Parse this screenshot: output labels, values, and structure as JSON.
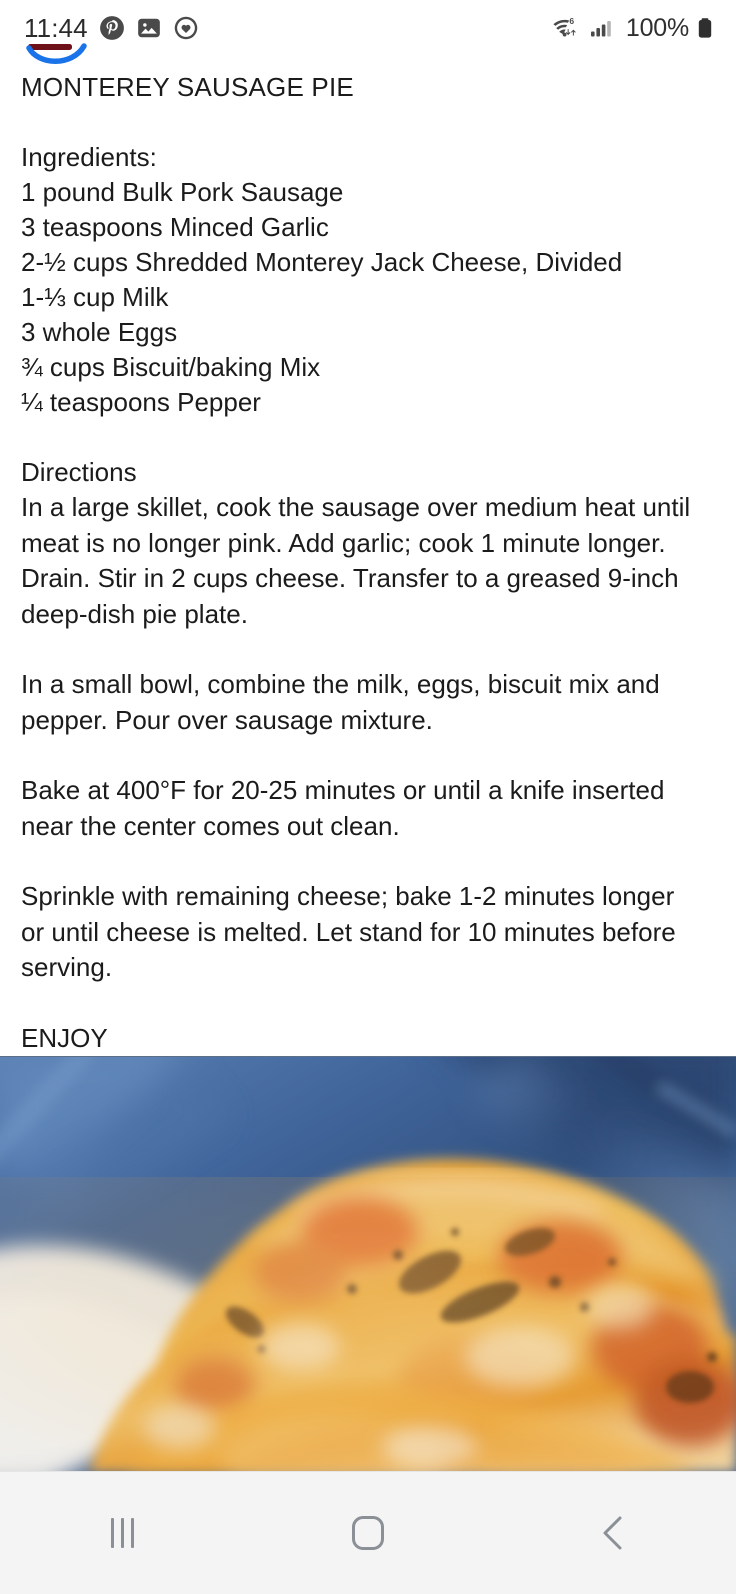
{
  "status_bar": {
    "time": "11:44",
    "battery_percent": "100%",
    "icons": [
      {
        "name": "pinterest-icon"
      },
      {
        "name": "gallery-photo-icon"
      },
      {
        "name": "samsung-health-heart-icon"
      }
    ],
    "right_icons": [
      {
        "name": "wifi-6-icon",
        "label": "6"
      },
      {
        "name": "cellular-signal-icon"
      },
      {
        "name": "battery-icon"
      }
    ],
    "accent_blue": "#1a73e8",
    "accent_dark_red": "#6e1118",
    "text_color": "#2b2b2b"
  },
  "recipe": {
    "title": "MONTEREY SAUSAGE PIE",
    "ingredients_heading": "Ingredients:",
    "ingredients": [
      "1 pound Bulk Pork Sausage",
      "3 teaspoons Minced Garlic",
      "2-½ cups Shredded Monterey Jack Cheese, Divided",
      "1-⅓ cup Milk",
      "3 whole Eggs",
      "¾ cups Biscuit/baking Mix",
      "¼ teaspoons Pepper"
    ],
    "directions_heading": "Directions",
    "directions": [
      "In a large skillet, cook the sausage over medium heat until meat is no longer pink. Add garlic; cook 1 minute longer. Drain. Stir in 2 cups cheese. Transfer to a greased 9-inch deep-dish pie plate.",
      "In a small bowl, combine the milk, eggs, biscuit mix and pepper. Pour over sausage mixture.",
      "Bake at 400°F for 20-25 minutes or until a knife inserted near the center comes out clean.",
      "Sprinkle with remaining cheese; bake 1-2 minutes longer or until cheese is melted. Let stand for 10 minutes before serving."
    ],
    "closing": "ENJOY",
    "text_color": "#1b1b1b"
  },
  "photo": {
    "name": "monterey-sausage-pie-photo",
    "description": "Close-up of baked cheesy sausage pie on a white plate over a blue cloth",
    "colors": {
      "cloth_blue": "#4a72a8",
      "cloth_blue_dark": "#2f4c7a",
      "cheese_gold": "#e9a93c",
      "cheese_light": "#f3d79a",
      "crust_orange": "#d97a2e",
      "char_brown": "#6a4320",
      "plate_white": "#eceff2"
    }
  },
  "nav_bar": {
    "background": "#f4f4f4",
    "icon_color": "#8b9097",
    "buttons": [
      {
        "name": "recents-button",
        "label": "Recents"
      },
      {
        "name": "home-button",
        "label": "Home"
      },
      {
        "name": "back-button",
        "label": "Back"
      }
    ]
  }
}
